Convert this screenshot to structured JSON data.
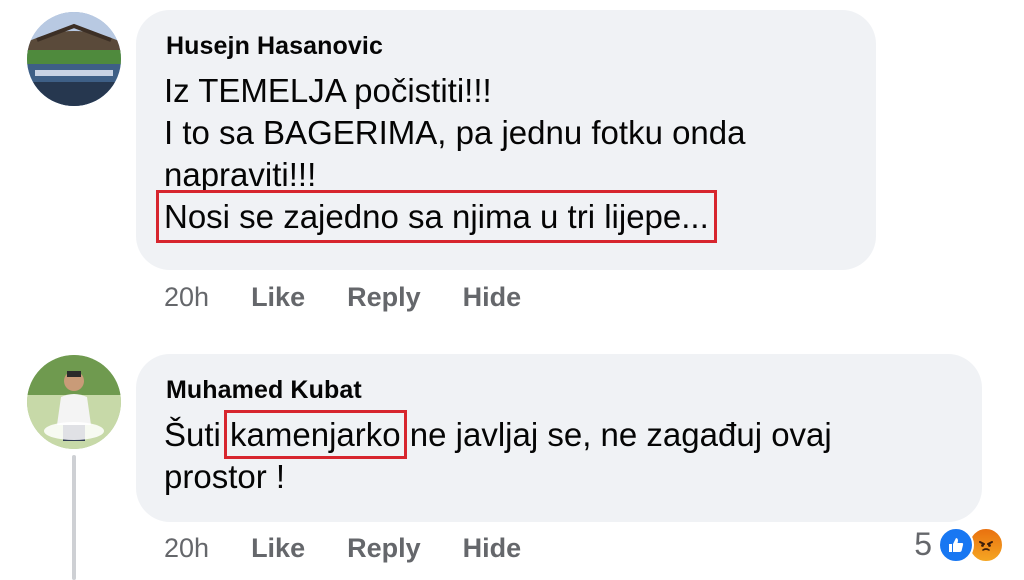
{
  "comments": [
    {
      "author": "Husejn Hasanovic",
      "lines": [
        "Iz TEMELJA počistiti!!!",
        "I to sa BAGERIMA, pa jednu fotku onda",
        "napraviti!!!",
        "Nosi se zajedno sa njima u tri lijepe..."
      ],
      "time": "20h",
      "actions": [
        "Like",
        "Reply",
        "Hide"
      ]
    },
    {
      "author": "Muhamed Kubat",
      "text_before": "Šuti ",
      "highlighted_word": "kamenjarko",
      "text_after": " ne javljaj se, ne zagađuj ovaj",
      "line2": "prostor !",
      "time": "20h",
      "actions": [
        "Like",
        "Reply",
        "Hide"
      ],
      "reactions": {
        "count": "5",
        "icons": [
          "like-icon",
          "angry-icon"
        ]
      }
    }
  ],
  "colors": {
    "bubble": "#f0f2f5",
    "highlight_box": "#d7262e",
    "secondary_text": "#65676b",
    "like_blue": "#1877f2"
  }
}
